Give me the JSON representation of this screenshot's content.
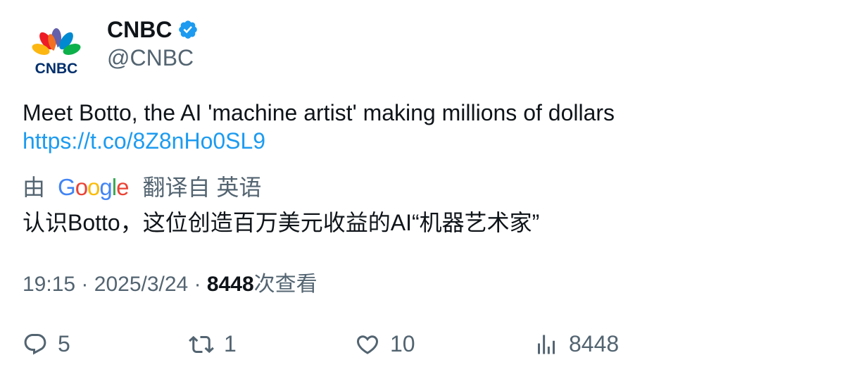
{
  "author": {
    "name": "CNBC",
    "handle": "@CNBC",
    "logo_text": "CNBC",
    "verified": true
  },
  "tweet": {
    "text": "Meet Botto, the AI 'machine artist' making millions of dollars",
    "link": "https://t.co/8Z8nHo0SL9"
  },
  "translation": {
    "by_label": "由",
    "provider": "Google",
    "from_label": "翻译自 英语",
    "text": "认识Botto，这位创造百万美元收益的AI“机器艺术家”"
  },
  "meta": {
    "time": "19:15",
    "separator": "·",
    "date": "2025/3/24",
    "views_count": "8448",
    "views_label": "次查看"
  },
  "actions": {
    "replies": "5",
    "retweets": "1",
    "likes": "10",
    "views": "8448"
  },
  "colors": {
    "link": "#1d9bf0",
    "muted": "#536471",
    "verified": "#1d9bf0",
    "text": "#0f1419"
  }
}
